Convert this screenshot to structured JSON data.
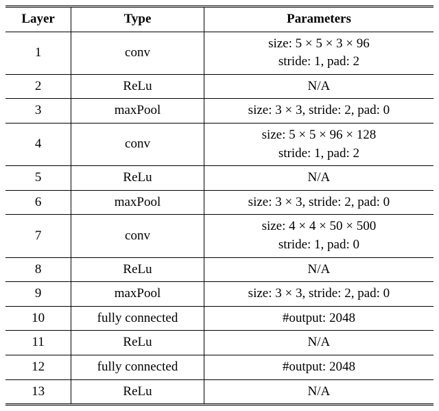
{
  "chart_data": {
    "type": "table",
    "columns": [
      "Layer",
      "Type",
      "Parameters"
    ],
    "rows": [
      {
        "layer": "1",
        "type": "conv",
        "parameters": "size: 5 × 5 × 3 × 96\nstride: 1, pad: 2"
      },
      {
        "layer": "2",
        "type": "ReLu",
        "parameters": "N/A"
      },
      {
        "layer": "3",
        "type": "maxPool",
        "parameters": "size: 3 × 3, stride: 2, pad: 0"
      },
      {
        "layer": "4",
        "type": "conv",
        "parameters": "size: 5 × 5 × 96 × 128\nstride: 1, pad: 2"
      },
      {
        "layer": "5",
        "type": "ReLu",
        "parameters": "N/A"
      },
      {
        "layer": "6",
        "type": "maxPool",
        "parameters": "size: 3 × 3, stride: 2, pad: 0"
      },
      {
        "layer": "7",
        "type": "conv",
        "parameters": "size: 4 × 4 × 50 × 500\nstride: 1, pad: 0"
      },
      {
        "layer": "8",
        "type": "ReLu",
        "parameters": "N/A"
      },
      {
        "layer": "9",
        "type": "maxPool",
        "parameters": "size: 3 × 3, stride: 2, pad: 0"
      },
      {
        "layer": "10",
        "type": "fully connected",
        "parameters": "#output: 2048"
      },
      {
        "layer": "11",
        "type": "ReLu",
        "parameters": "N/A"
      },
      {
        "layer": "12",
        "type": "fully connected",
        "parameters": "#output: 2048"
      },
      {
        "layer": "13",
        "type": "ReLu",
        "parameters": "N/A"
      }
    ]
  },
  "table": {
    "header": {
      "layer": "Layer",
      "type": "Type",
      "parameters": "Parameters"
    },
    "rows": [
      {
        "layer": "1",
        "type": "conv",
        "p1": "size: 5 × 5 × 3 × 96",
        "p2": "stride: 1, pad: 2"
      },
      {
        "layer": "2",
        "type": "ReLu",
        "p1": "N/A"
      },
      {
        "layer": "3",
        "type": "maxPool",
        "p1": "size: 3 × 3, stride: 2, pad: 0"
      },
      {
        "layer": "4",
        "type": "conv",
        "p1": "size: 5 × 5 × 96 × 128",
        "p2": "stride: 1, pad: 2"
      },
      {
        "layer": "5",
        "type": "ReLu",
        "p1": "N/A"
      },
      {
        "layer": "6",
        "type": "maxPool",
        "p1": "size: 3 × 3, stride: 2, pad: 0"
      },
      {
        "layer": "7",
        "type": "conv",
        "p1": "size: 4 × 4 × 50 × 500",
        "p2": "stride: 1, pad: 0"
      },
      {
        "layer": "8",
        "type": "ReLu",
        "p1": "N/A"
      },
      {
        "layer": "9",
        "type": "maxPool",
        "p1": "size: 3 × 3, stride: 2, pad: 0"
      },
      {
        "layer": "10",
        "type": "fully connected",
        "p1": "#output: 2048"
      },
      {
        "layer": "11",
        "type": "ReLu",
        "p1": "N/A"
      },
      {
        "layer": "12",
        "type": "fully connected",
        "p1": "#output: 2048"
      },
      {
        "layer": "13",
        "type": "ReLu",
        "p1": "N/A"
      }
    ]
  }
}
